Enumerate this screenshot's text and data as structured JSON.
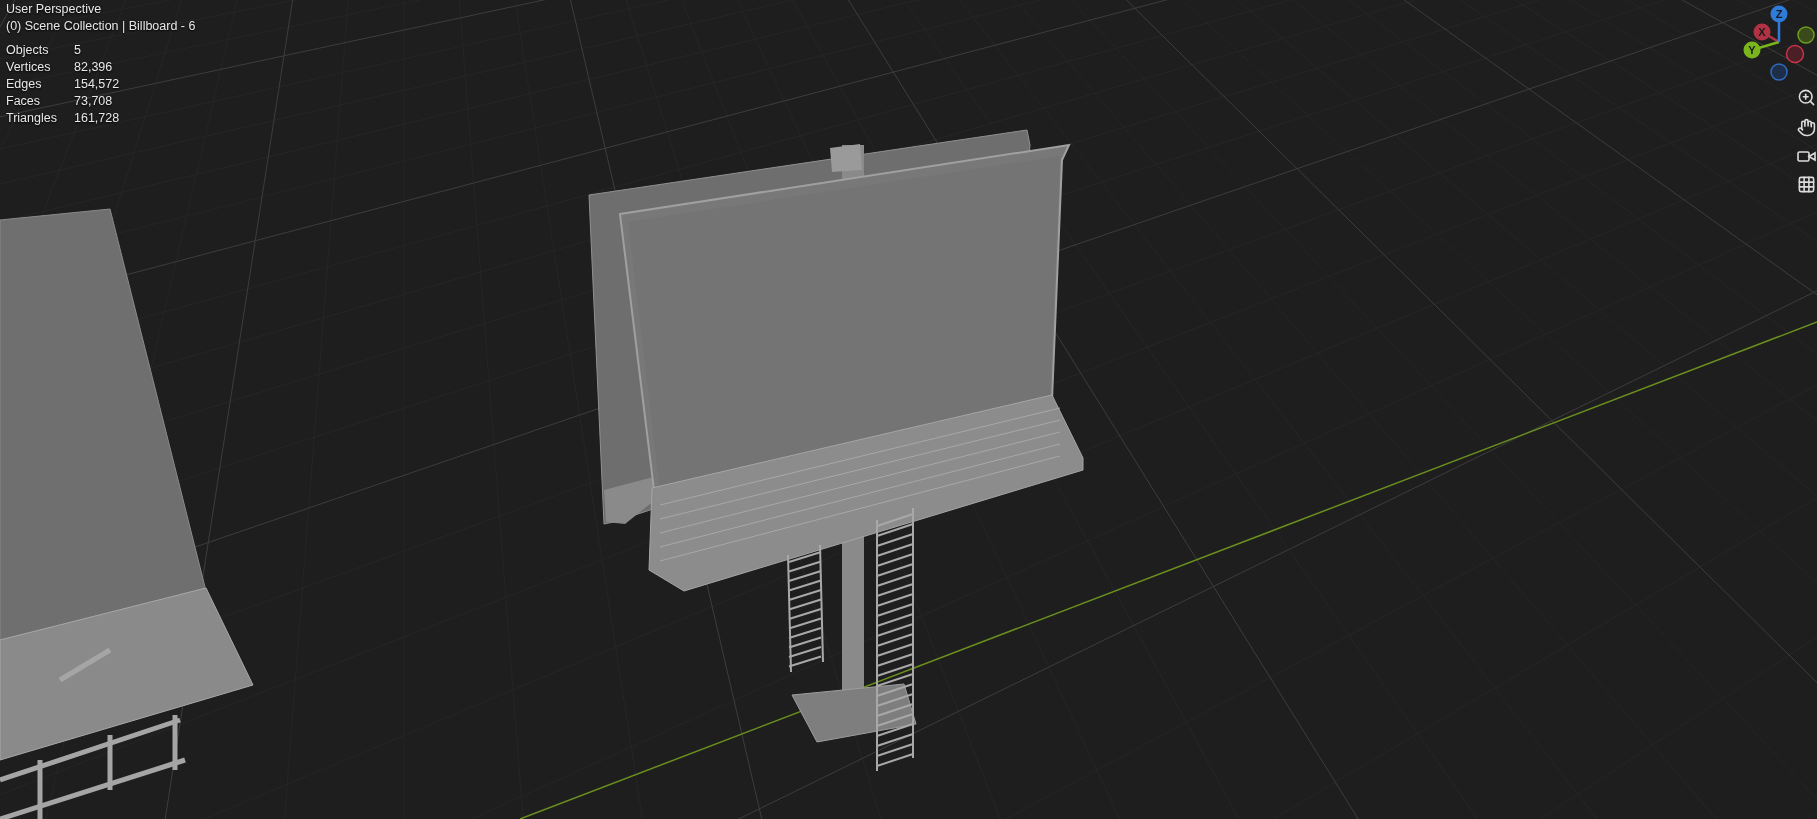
{
  "viewport": {
    "view_name": "User Perspective",
    "context": "(0) Scene Collection | Billboard - 6"
  },
  "stats": [
    {
      "label": "Objects",
      "value": "5"
    },
    {
      "label": "Vertices",
      "value": "82,396"
    },
    {
      "label": "Edges",
      "value": "154,572"
    },
    {
      "label": "Faces",
      "value": "73,708"
    },
    {
      "label": "Triangles",
      "value": "161,728"
    }
  ],
  "gizmo": {
    "axes": [
      {
        "label": "X",
        "color": "#b23244"
      },
      {
        "label": "Y",
        "color": "#7ab51d"
      },
      {
        "label": "Z",
        "color": "#2f7bd9"
      }
    ]
  }
}
